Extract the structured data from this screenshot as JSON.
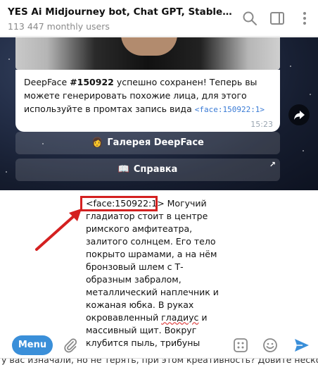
{
  "header": {
    "title": "YES Ai Midjourney bot, Chat GPT, Stable Diffusio...",
    "subtitle": "113 447 monthly users",
    "icons": [
      "search-icon",
      "panel-icon",
      "more-icon"
    ]
  },
  "message": {
    "saved_prefix": "DeepFace ",
    "saved_id": "#150922",
    "saved_suffix": " успешно сохранен! Теперь вы можете генерировать похожие лица, для этого используйте в промтах запись вида ",
    "code": "<face:150922:1>",
    "time": "15:23"
  },
  "inline_buttons": {
    "gallery_emoji": "👩",
    "gallery_label": "Галерея DeepFace",
    "help_emoji": "📖",
    "help_label": "Справка",
    "help_arrow": "↗"
  },
  "compose": {
    "tag": "<face:150922:1>",
    "text_after_tag": " Могучий гладиатор стоит в центре римского амфитеатра, залитого солнцем. Его тело покрыто шрамами, а на нём бронзовый шлем с Т-образным забралом, металлический наплечник и кожаная юбка. В руках окровавленный ",
    "squiggle_word": "гладиус",
    "text_end": " и массивный щит. Вокруг клубится пыль, трибуны"
  },
  "bottom_bar": {
    "menu_label": "Menu",
    "icons": [
      "attach-icon",
      "commands-icon",
      "emoji-icon",
      "send-icon"
    ]
  },
  "below_window_text": "у вас изначали, но не терять, при этом креативность? Довите неско",
  "colors": {
    "accent": "#3a8fd9",
    "highlight": "#d42020",
    "code": "#3a7bd5"
  }
}
